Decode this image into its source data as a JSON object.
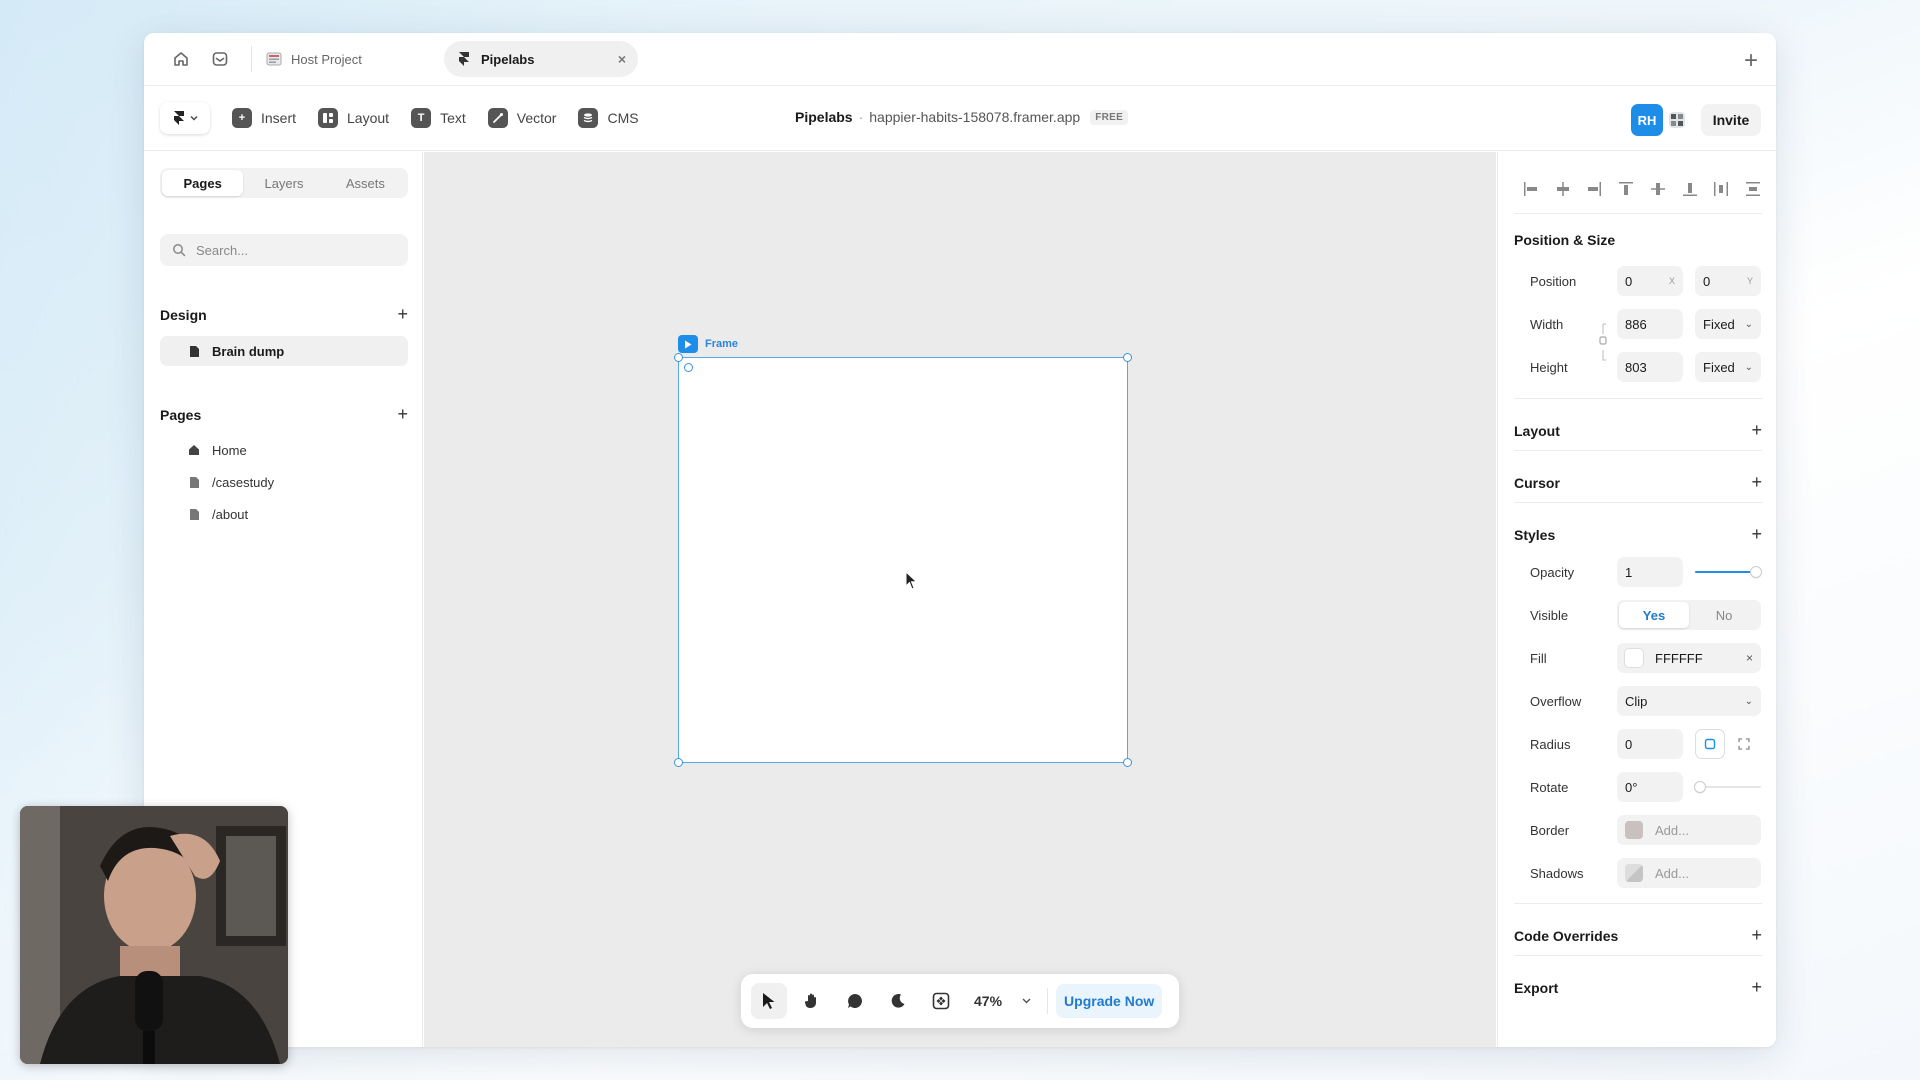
{
  "tabbar": {
    "tabs": [
      {
        "label": "Host Project",
        "active": false
      },
      {
        "label": "Pipelabs",
        "active": true
      }
    ],
    "close_symbol": "×",
    "new_tab_symbol": "+"
  },
  "toolbar": {
    "items": [
      {
        "label": "Insert",
        "icon": "plus-icon"
      },
      {
        "label": "Layout",
        "icon": "layout-icon"
      },
      {
        "label": "Text",
        "icon": "text-icon"
      },
      {
        "label": "Vector",
        "icon": "vector-icon"
      },
      {
        "label": "CMS",
        "icon": "database-icon"
      }
    ],
    "project_name": "Pipelabs",
    "separator": "·",
    "site_url": "happier-habits-158078.framer.app",
    "plan_badge": "FREE",
    "avatar_initials": "RH",
    "invite_label": "Invite",
    "accent_color": "#1e8de8"
  },
  "left_panel": {
    "tabs": [
      "Pages",
      "Layers",
      "Assets"
    ],
    "active_tab": "Pages",
    "search_placeholder": "Search...",
    "design_heading": "Design",
    "design_items": [
      {
        "label": "Brain dump"
      }
    ],
    "pages_heading": "Pages",
    "pages": [
      {
        "label": "Home",
        "icon": "home-icon"
      },
      {
        "label": "/casestudy",
        "icon": "page-icon"
      },
      {
        "label": "/about",
        "icon": "page-icon"
      }
    ],
    "add_symbol": "+"
  },
  "canvas": {
    "frame_label": "Frame",
    "background": "#ebebeb",
    "frame_fill": "#ffffff",
    "selection_color": "#3a93de"
  },
  "bottom_bar": {
    "zoom": "47%",
    "upgrade_label": "Upgrade Now"
  },
  "right_panel": {
    "position_size": {
      "heading": "Position & Size",
      "position_label": "Position",
      "x_value": "0",
      "x_suffix": "X",
      "y_value": "0",
      "y_suffix": "Y",
      "width_label": "Width",
      "width_value": "886",
      "width_mode": "Fixed",
      "height_label": "Height",
      "height_value": "803",
      "height_mode": "Fixed"
    },
    "layout_heading": "Layout",
    "cursor_heading": "Cursor",
    "styles": {
      "heading": "Styles",
      "opacity_label": "Opacity",
      "opacity_value": "1",
      "opacity_level": 1.0,
      "visible_label": "Visible",
      "visible_yes": "Yes",
      "visible_no": "No",
      "fill_label": "Fill",
      "fill_value": "FFFFFF",
      "overflow_label": "Overflow",
      "overflow_value": "Clip",
      "radius_label": "Radius",
      "radius_value": "0",
      "rotate_label": "Rotate",
      "rotate_value": "0°",
      "rotate_level": 0.0,
      "border_label": "Border",
      "border_placeholder": "Add...",
      "shadows_label": "Shadows",
      "shadows_placeholder": "Add..."
    },
    "code_overrides_heading": "Code Overrides",
    "export_heading": "Export",
    "add_symbol": "+"
  }
}
